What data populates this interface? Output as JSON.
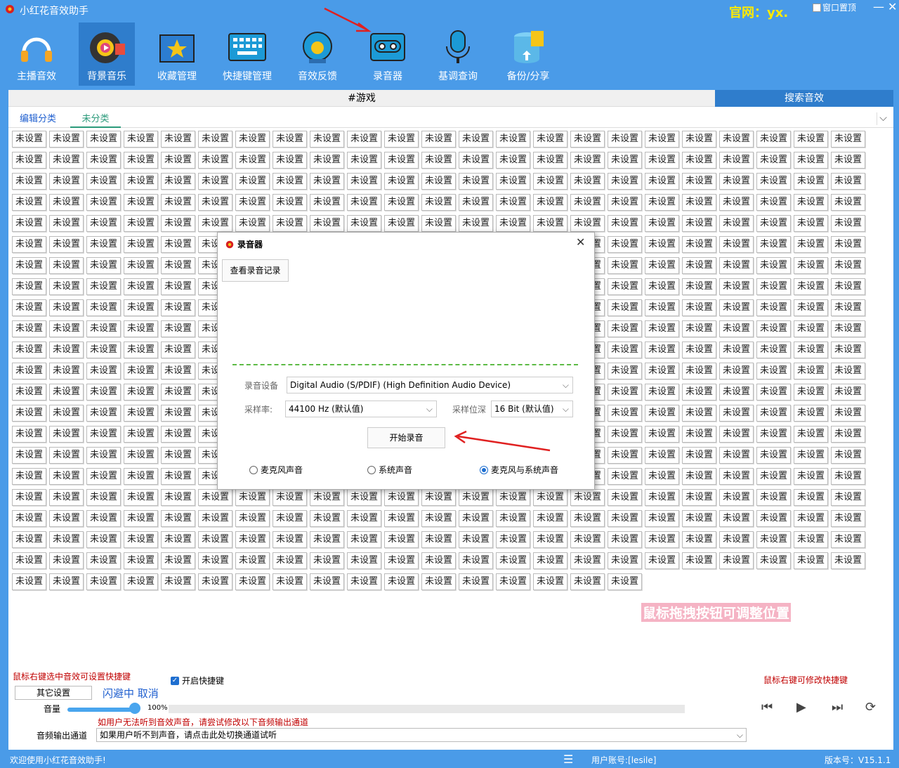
{
  "app": {
    "title": "小红花音效助手",
    "site": "官网：yx.",
    "pin_label": "窗口置顶"
  },
  "toolbar": [
    {
      "id": "anchor",
      "label": "主播音效",
      "icon": "headphones-icon",
      "active": false
    },
    {
      "id": "bgm",
      "label": "背景音乐",
      "icon": "music-disc-icon",
      "active": true
    },
    {
      "id": "fav",
      "label": "收藏管理",
      "icon": "star-folder-icon",
      "active": false
    },
    {
      "id": "hotkey",
      "label": "快捷键管理",
      "icon": "keyboard-icon",
      "active": false
    },
    {
      "id": "feedback",
      "label": "音效反馈",
      "icon": "feedback-icon",
      "active": false
    },
    {
      "id": "recorder",
      "label": "录音器",
      "icon": "cassette-icon",
      "active": false
    },
    {
      "id": "pitch",
      "label": "基调查询",
      "icon": "microphone-icon",
      "active": false
    },
    {
      "id": "backup",
      "label": "备份/分享",
      "icon": "backup-icon",
      "active": false
    }
  ],
  "main": {
    "tag_title": "#游戏",
    "search_label": "搜索音效",
    "tabs": {
      "edit": "编辑分类",
      "uncategorized": "未分类"
    },
    "slot_label": "未设置",
    "hint_drag": "鼠标拖拽按钮可调整位置",
    "hint_right_click": "鼠标右键选中音效可设置快捷键",
    "hint_right_modify": "鼠标右键可修改快捷键",
    "hotkey_enable": "开启快捷键",
    "other_settings": "其它设置",
    "ducking": "闪避中 取消",
    "volume_label": "音量",
    "volume_pct": "100%",
    "volume_value": 100,
    "warn": "如用户无法听到音效声音，请尝试修改以下音频输出通道",
    "output_label": "音频输出通道",
    "output_value": "如果用户听不到声音，请点击此处切换通道试听"
  },
  "status": {
    "welcome": "欢迎使用小红花音效助手!",
    "account": "用户账号:[lesile]",
    "version": "版本号：V15.1.1"
  },
  "dialog": {
    "title": "录音器",
    "history_button": "查看录音记录",
    "device_label": "录音设备",
    "device_value": "Digital Audio (S/PDIF) (High Definition Audio Device)",
    "rate_label": "采样率:",
    "rate_value": "44100 Hz (默认值)",
    "depth_label": "采样位深",
    "depth_value": "16 Bit (默认值)",
    "start_button": "开始录音",
    "radios": [
      {
        "label": "麦克风声音",
        "checked": false
      },
      {
        "label": "系统声音",
        "checked": false
      },
      {
        "label": "麦克风与系统声音",
        "checked": true
      }
    ]
  },
  "colors": {
    "accent": "#4a9be8",
    "active": "#2f7dcc",
    "warning": "#c00000",
    "annotation_arrow": "#e02020"
  }
}
